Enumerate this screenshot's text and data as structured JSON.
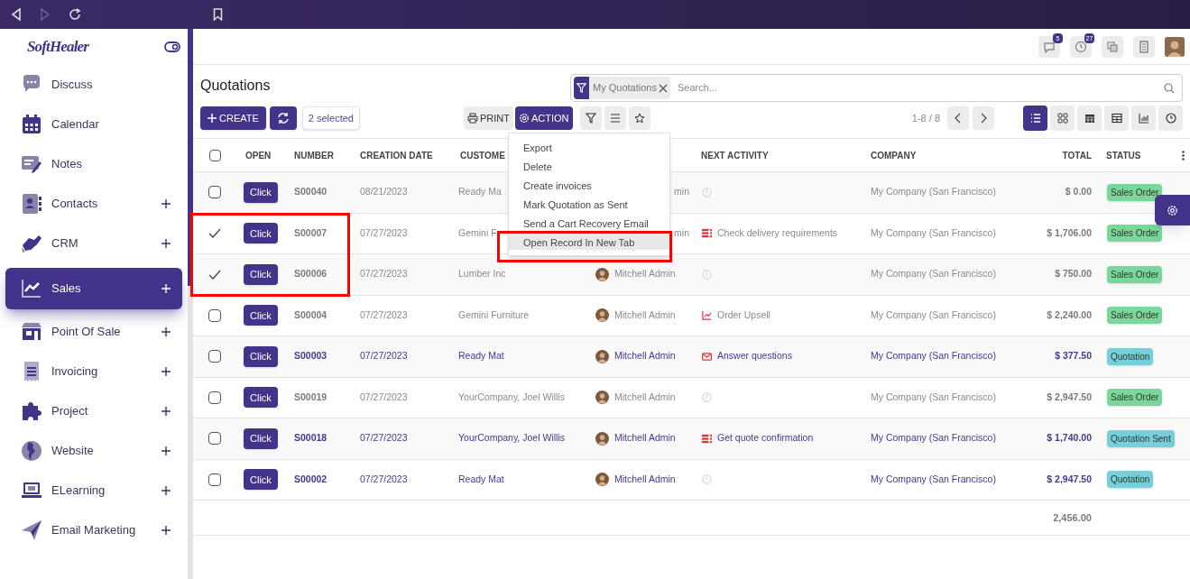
{
  "brand": {
    "logo": "SoftHealer"
  },
  "sidebar": {
    "items": [
      {
        "label": "Discuss",
        "expandable": false,
        "selected": false
      },
      {
        "label": "Calendar",
        "expandable": false,
        "selected": false
      },
      {
        "label": "Notes",
        "expandable": false,
        "selected": false
      },
      {
        "label": "Contacts",
        "expandable": true,
        "selected": false
      },
      {
        "label": "CRM",
        "expandable": true,
        "selected": false
      },
      {
        "label": "Sales",
        "expandable": true,
        "selected": true
      },
      {
        "label": "Point Of Sale",
        "expandable": true,
        "selected": false
      },
      {
        "label": "Invoicing",
        "expandable": true,
        "selected": false
      },
      {
        "label": "Project",
        "expandable": true,
        "selected": false
      },
      {
        "label": "Website",
        "expandable": true,
        "selected": false
      },
      {
        "label": "ELearning",
        "expandable": true,
        "selected": false
      },
      {
        "label": "Email Marketing",
        "expandable": true,
        "selected": false
      }
    ]
  },
  "topbar": {
    "messages_badge": "5",
    "activities_badge": "27"
  },
  "page": {
    "title": "Quotations"
  },
  "search": {
    "facet": "My Quotations",
    "placeholder": "Search..."
  },
  "toolbar": {
    "create": "CREATE",
    "selection": "2 selected",
    "print": "PRINT",
    "action": "ACTION",
    "pager": "1-8 / 8"
  },
  "views": [
    {
      "selected": true
    },
    {
      "selected": false
    },
    {
      "selected": false
    },
    {
      "selected": false
    },
    {
      "selected": false
    },
    {
      "selected": false
    }
  ],
  "action_menu": {
    "items": [
      {
        "label": "Export",
        "selected": false
      },
      {
        "label": "Delete",
        "selected": false
      },
      {
        "label": "Create invoices",
        "selected": false
      },
      {
        "label": "Mark Quotation as Sent",
        "selected": false
      },
      {
        "label": "Send a Cart Recovery Email",
        "selected": false
      },
      {
        "label": "Open Record In New Tab",
        "selected": true
      }
    ]
  },
  "table": {
    "all_selected": false,
    "columns": {
      "open": "OPEN",
      "number": "NUMBER",
      "creation_date": "CREATION DATE",
      "customer": "CUSTOME",
      "next_activity": "NEXT ACTIVITY",
      "company": "COMPANY",
      "total": "TOTAL",
      "status": "STATUS"
    },
    "rows": [
      {
        "selected": false,
        "emphasized": false,
        "open": "Click",
        "number": "S00040",
        "date": "08/21/2023",
        "customer": "Ready Ma",
        "salesperson": "min",
        "avatar": false,
        "activity": {
          "kind": "none"
        },
        "company": "My Company (San Francisco)",
        "total": "$ 0.00",
        "status": "Sales Order",
        "color": "#7bd69b"
      },
      {
        "selected": true,
        "emphasized": false,
        "open": "Click",
        "number": "S00007",
        "date": "07/27/2023",
        "customer": "Gemini F",
        "salesperson": "min",
        "avatar": false,
        "activity": {
          "kind": "todo",
          "label": "Check delivery requirements"
        },
        "company": "My Company (San Francisco)",
        "total": "$ 1,706.00",
        "status": "Sales Order",
        "color": "#7bd69b"
      },
      {
        "selected": true,
        "emphasized": false,
        "open": "Click",
        "number": "S00006",
        "date": "07/27/2023",
        "customer": "Lumber Inc",
        "salesperson": "Mitchell Admin",
        "avatar": true,
        "activity": {
          "kind": "none"
        },
        "company": "My Company (San Francisco)",
        "total": "$ 750.00",
        "status": "Sales Order",
        "color": "#7bd69b"
      },
      {
        "selected": false,
        "emphasized": false,
        "open": "Click",
        "number": "S00004",
        "date": "07/27/2023",
        "customer": "Gemini Furniture",
        "salesperson": "Mitchell Admin",
        "avatar": true,
        "activity": {
          "kind": "upsell",
          "label": "Order Upsell"
        },
        "company": "My Company (San Francisco)",
        "total": "$ 2,240.00",
        "status": "Sales Order",
        "color": "#7bd69b"
      },
      {
        "selected": false,
        "emphasized": true,
        "open": "Click",
        "number": "S00003",
        "date": "07/27/2023",
        "customer": "Ready Mat",
        "salesperson": "Mitchell Admin",
        "avatar": true,
        "activity": {
          "kind": "email",
          "label": "Answer questions"
        },
        "company": "My Company (San Francisco)",
        "total": "$ 377.50",
        "status": "Quotation",
        "color": "#77cfdc"
      },
      {
        "selected": false,
        "emphasized": false,
        "open": "Click",
        "number": "S00019",
        "date": "07/27/2023",
        "customer": "YourCompany, Joel Willis",
        "salesperson": "Mitchell Admin",
        "avatar": true,
        "activity": {
          "kind": "none"
        },
        "company": "My Company (San Francisco)",
        "total": "$ 2,947.50",
        "status": "Sales Order",
        "color": "#7bd69b"
      },
      {
        "selected": false,
        "emphasized": true,
        "open": "Click",
        "number": "S00018",
        "date": "07/27/2023",
        "customer": "YourCompany, Joel Willis",
        "salesperson": "Mitchell Admin",
        "avatar": true,
        "activity": {
          "kind": "todo",
          "label": "Get quote confirmation"
        },
        "company": "My Company (San Francisco)",
        "total": "$ 1,740.00",
        "status": "Quotation Sent",
        "color": "#77cfdc"
      },
      {
        "selected": false,
        "emphasized": true,
        "open": "Click",
        "number": "S00002",
        "date": "07/27/2023",
        "customer": "Ready Mat",
        "salesperson": "Mitchell Admin",
        "avatar": true,
        "activity": {
          "kind": "none"
        },
        "company": "My Company (San Francisco)",
        "total": "$ 2,947.50",
        "status": "Quotation",
        "color": "#77cfdc"
      }
    ],
    "footer_total": "2,456.00"
  }
}
